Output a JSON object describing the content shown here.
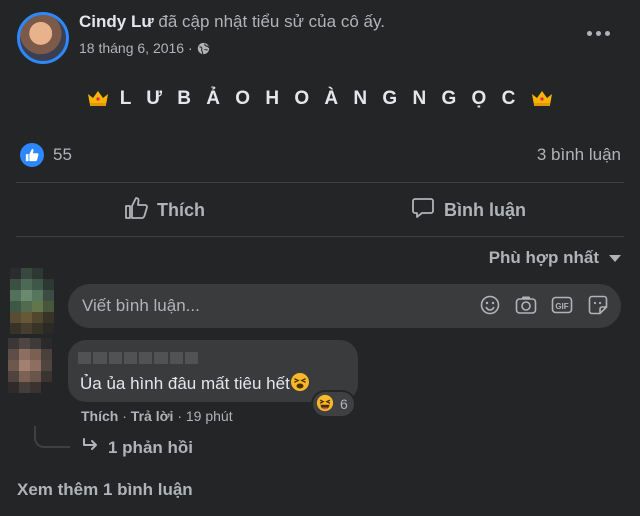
{
  "post": {
    "author_name": "Cindy Lư",
    "action_text": "đã cập nhật tiểu sử của cô ấy.",
    "date": "18 tháng 6, 2016",
    "privacy_icon": "globe-icon",
    "body_text": "L Ư B Ả O H O À N G N G Ọ C",
    "decor_icon": "crown-emoji"
  },
  "reactions": {
    "count": "55",
    "comment_count": "3 bình luận"
  },
  "actions": {
    "like_label": "Thích",
    "comment_label": "Bình luận"
  },
  "sort": {
    "selected": "Phù hợp nhất"
  },
  "composer": {
    "placeholder": "Viết bình luận...",
    "tools": [
      "emoji-icon",
      "camera-icon",
      "gif-icon",
      "sticker-icon"
    ]
  },
  "comment": {
    "text": "Ủa ủa hình đâu mất tiêu hết",
    "reaction_count": "6",
    "like_label": "Thích",
    "reply_label": "Trả lời",
    "time": "19 phút",
    "replies_label": "1 phản hồi"
  },
  "footer": {
    "more_comments": "Xem thêm 1 bình luận"
  },
  "colors": {
    "background": "#242526",
    "bubble": "#3a3b3c",
    "accent": "#2d88ff",
    "text_primary": "#e4e6eb",
    "text_secondary": "#b0b3b8"
  }
}
